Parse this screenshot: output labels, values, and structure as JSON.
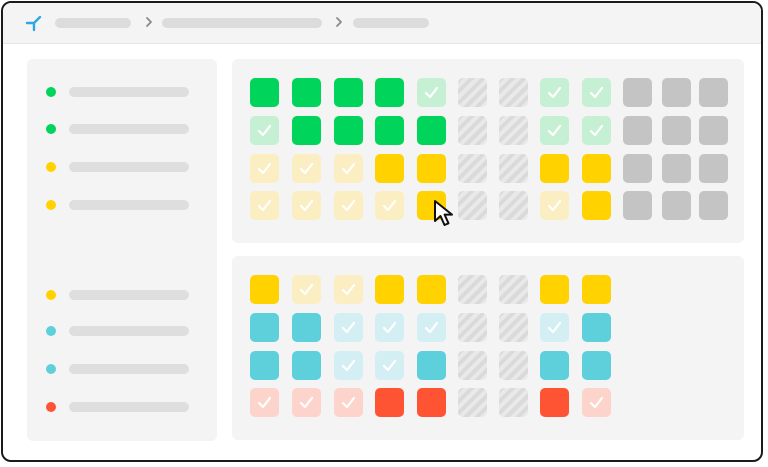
{
  "topbar": {
    "logo_icon": "branch-logo-icon",
    "breadcrumb_separator_icon": "chevron-right-icon"
  },
  "colors": {
    "green": "#00d45a",
    "green_light": "#c5f0d4",
    "yellow": "#ffd200",
    "yellow_light": "#fbeec2",
    "cyan": "#5dd0dc",
    "cyan_light": "#d4eff3",
    "red": "#ff5434",
    "red_light": "#fcd4cc",
    "gray": "#c4c4c4",
    "hatch_bg": "#e9e9e9",
    "hatch_stripe": "#dadada",
    "check": "#ffffff"
  },
  "sidebar": {
    "items": [
      {
        "color": "#00d45a"
      },
      {
        "color": "#00d45a"
      },
      {
        "color": "#ffd200"
      },
      {
        "color": "#ffd200"
      },
      {
        "color": "#ffd200"
      },
      {
        "color": "#5dd0dc"
      },
      {
        "color": "#5dd0dc"
      },
      {
        "color": "#ff5434"
      }
    ]
  },
  "grids": [
    {
      "name": "top-grid",
      "rows": [
        [
          "G",
          "G",
          "G",
          "G",
          "g",
          "h",
          "h",
          "g",
          "g",
          "x",
          "x",
          "x"
        ],
        [
          "g",
          "G",
          "G",
          "G",
          "G",
          "h",
          "h",
          "g",
          "g",
          "x",
          "x",
          "x"
        ],
        [
          "y",
          "y",
          "y",
          "Y",
          "Y",
          "h",
          "h",
          "Y",
          "Y",
          "x",
          "x",
          "x"
        ],
        [
          "y",
          "y",
          "y",
          "y",
          "Y",
          "h",
          "h",
          "y",
          "Y",
          "x",
          "x",
          "x"
        ]
      ]
    },
    {
      "name": "bottom-grid",
      "rows": [
        [
          "Y",
          "y",
          "y",
          "Y",
          "Y",
          "h",
          "h",
          "Y",
          "Y"
        ],
        [
          "C",
          "C",
          "c",
          "c",
          "c",
          "h",
          "h",
          "c",
          "C"
        ],
        [
          "C",
          "C",
          "c",
          "c",
          "C",
          "h",
          "h",
          "C",
          "C"
        ],
        [
          "r",
          "r",
          "r",
          "R",
          "R",
          "h",
          "h",
          "R",
          "r"
        ]
      ]
    }
  ],
  "cursor_icon": "mouse-pointer-icon"
}
